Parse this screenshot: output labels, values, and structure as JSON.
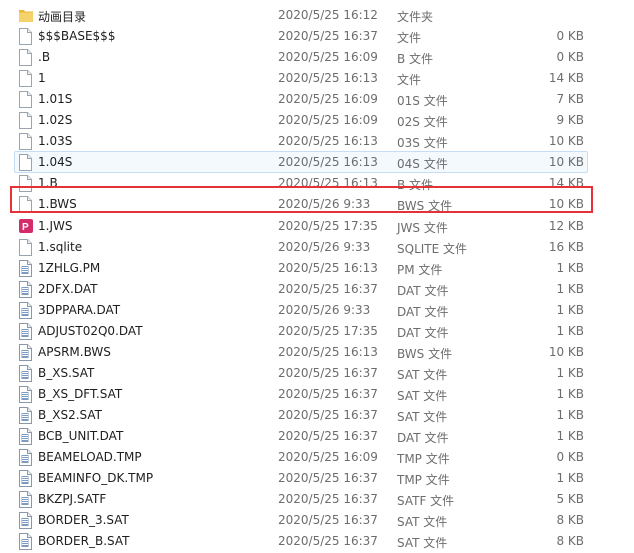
{
  "rows": [
    {
      "name": "动画目录",
      "date": "2020/5/25 16:12",
      "type": "文件夹",
      "size": "",
      "icon": "folder-icon"
    },
    {
      "name": "$$$BASE$$$",
      "date": "2020/5/25 16:37",
      "type": "文件",
      "size": "0 KB",
      "icon": "file-icon"
    },
    {
      "name": ".B",
      "date": "2020/5/25 16:09",
      "type": "B 文件",
      "size": "0 KB",
      "icon": "file-icon"
    },
    {
      "name": "1",
      "date": "2020/5/25 16:13",
      "type": "文件",
      "size": "14 KB",
      "icon": "file-icon"
    },
    {
      "name": "1.01S",
      "date": "2020/5/25 16:09",
      "type": "01S 文件",
      "size": "7 KB",
      "icon": "file-icon"
    },
    {
      "name": "1.02S",
      "date": "2020/5/25 16:09",
      "type": "02S 文件",
      "size": "9 KB",
      "icon": "file-icon"
    },
    {
      "name": "1.03S",
      "date": "2020/5/25 16:13",
      "type": "03S 文件",
      "size": "10 KB",
      "icon": "file-icon"
    },
    {
      "name": "1.04S",
      "date": "2020/5/25 16:13",
      "type": "04S 文件",
      "size": "10 KB",
      "icon": "file-icon"
    },
    {
      "name": "1.B",
      "date": "2020/5/25 16:13",
      "type": "B 文件",
      "size": "14 KB",
      "icon": "file-icon"
    },
    {
      "name": "1.BWS",
      "date": "2020/5/26 9:33",
      "type": "BWS 文件",
      "size": "10 KB",
      "icon": "file-icon"
    },
    {
      "name": "1.JWS",
      "date": "2020/5/25 17:35",
      "type": "JWS 文件",
      "size": "12 KB",
      "icon": "jws-app-icon"
    },
    {
      "name": "1.sqlite",
      "date": "2020/5/26 9:33",
      "type": "SQLITE 文件",
      "size": "16 KB",
      "icon": "file-icon"
    },
    {
      "name": "1ZHLG.PM",
      "date": "2020/5/25 16:13",
      "type": "PM 文件",
      "size": "1 KB",
      "icon": "document-icon"
    },
    {
      "name": "2DFX.DAT",
      "date": "2020/5/25 16:37",
      "type": "DAT 文件",
      "size": "1 KB",
      "icon": "document-icon"
    },
    {
      "name": "3DPPARA.DAT",
      "date": "2020/5/26 9:33",
      "type": "DAT 文件",
      "size": "1 KB",
      "icon": "document-icon"
    },
    {
      "name": "ADJUST02Q0.DAT",
      "date": "2020/5/25 17:35",
      "type": "DAT 文件",
      "size": "1 KB",
      "icon": "document-icon"
    },
    {
      "name": "APSRM.BWS",
      "date": "2020/5/25 16:13",
      "type": "BWS 文件",
      "size": "10 KB",
      "icon": "document-icon"
    },
    {
      "name": "B_XS.SAT",
      "date": "2020/5/25 16:37",
      "type": "SAT 文件",
      "size": "1 KB",
      "icon": "document-icon"
    },
    {
      "name": "B_XS_DFT.SAT",
      "date": "2020/5/25 16:37",
      "type": "SAT 文件",
      "size": "1 KB",
      "icon": "document-icon"
    },
    {
      "name": "B_XS2.SAT",
      "date": "2020/5/25 16:37",
      "type": "SAT 文件",
      "size": "1 KB",
      "icon": "document-icon"
    },
    {
      "name": "BCB_UNIT.DAT",
      "date": "2020/5/25 16:37",
      "type": "DAT 文件",
      "size": "1 KB",
      "icon": "document-icon"
    },
    {
      "name": "BEAMELOAD.TMP",
      "date": "2020/5/25 16:09",
      "type": "TMP 文件",
      "size": "0 KB",
      "icon": "document-icon"
    },
    {
      "name": "BEAMINFO_DK.TMP",
      "date": "2020/5/25 16:37",
      "type": "TMP 文件",
      "size": "1 KB",
      "icon": "document-icon"
    },
    {
      "name": "BKZPJ.SATF",
      "date": "2020/5/25 16:37",
      "type": "SATF 文件",
      "size": "5 KB",
      "icon": "document-icon"
    },
    {
      "name": "BORDER_3.SAT",
      "date": "2020/5/25 16:37",
      "type": "SAT 文件",
      "size": "8 KB",
      "icon": "document-icon"
    },
    {
      "name": "BORDER_B.SAT",
      "date": "2020/5/25 16:37",
      "type": "SAT 文件",
      "size": "8 KB",
      "icon": "document-icon"
    }
  ],
  "colors": {
    "highlight": "#e53238",
    "hover_border": "#c6ddf3",
    "folder": "#e8b83c"
  }
}
